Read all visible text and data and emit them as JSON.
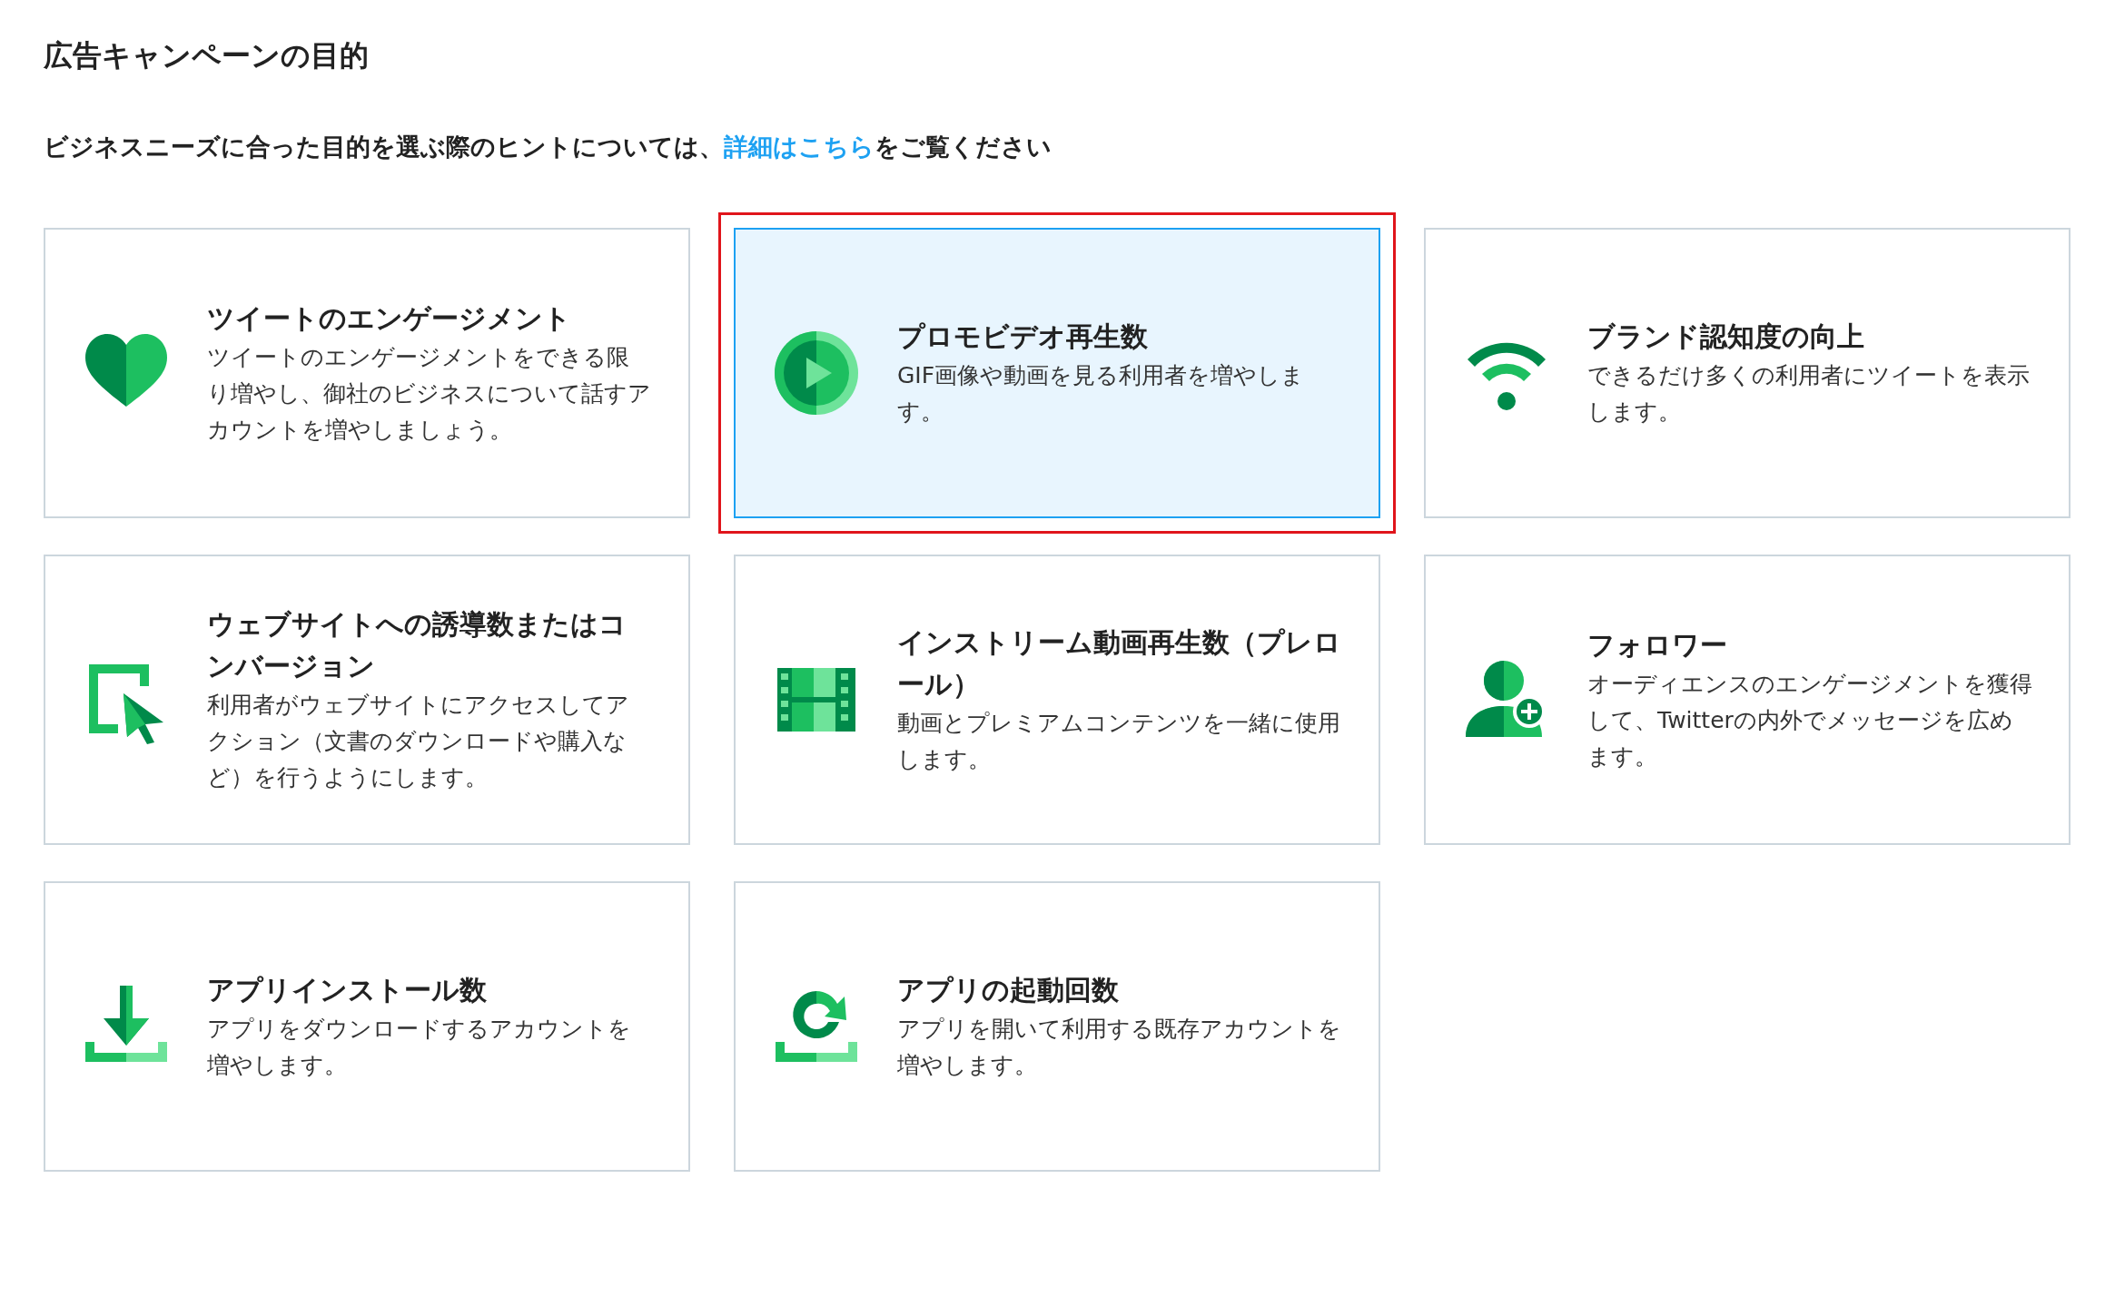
{
  "title": "広告キャンペーンの目的",
  "hint": {
    "before": "ビジネスニーズに合った目的を選ぶ際のヒントについては、",
    "link": "詳細はこちら",
    "after": "をご覧ください"
  },
  "objectives": [
    {
      "kind": "heart",
      "title": "ツイートのエンゲージメント",
      "description": "ツイートのエンゲージメントをできる限り増やし、御社のビジネスについて話すアカウントを増やしましょう。",
      "selected": false
    },
    {
      "kind": "play",
      "title": "プロモビデオ再生数",
      "description": "GIF画像や動画を見る利用者を増やします。",
      "selected": true
    },
    {
      "kind": "signal",
      "title": "ブランド認知度の向上",
      "description": "できるだけ多くの利用者にツイートを表示します。",
      "selected": false
    },
    {
      "kind": "cursor",
      "title": "ウェブサイトへの誘導数またはコンバージョン",
      "description": "利用者がウェブサイトにアクセスしてアクション（文書のダウンロードや購入など）を行うようにします。",
      "selected": false
    },
    {
      "kind": "film",
      "title": "インストリーム動画再生数（プレロール）",
      "description": "動画とプレミアムコンテンツを一緒に使用します。",
      "selected": false
    },
    {
      "kind": "follower",
      "title": "フォロワー",
      "description": "オーディエンスのエンゲージメントを獲得して、Twitterの内外でメッセージを広めます。",
      "selected": false
    },
    {
      "kind": "download",
      "title": "アプリインストール数",
      "description": "アプリをダウンロードするアカウントを増やします。",
      "selected": false
    },
    {
      "kind": "refresh",
      "title": "アプリの起動回数",
      "description": "アプリを開いて利用する既存アカウントを増やします。",
      "selected": false
    }
  ]
}
